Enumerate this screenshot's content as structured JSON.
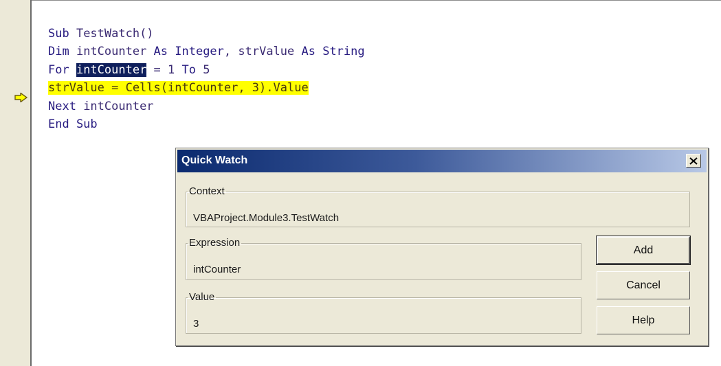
{
  "editor": {
    "code_lines": [
      {
        "parts": [
          {
            "text": "Sub ",
            "cls": "kw"
          },
          {
            "text": "TestWatch()",
            "cls": ""
          }
        ]
      },
      {
        "parts": [
          {
            "text": "Dim ",
            "cls": "kw"
          },
          {
            "text": "intCounter ",
            "cls": ""
          },
          {
            "text": "As Integer",
            "cls": "kw"
          },
          {
            "text": ", strValue ",
            "cls": ""
          },
          {
            "text": "As String",
            "cls": "kw"
          }
        ]
      },
      {
        "parts": [
          {
            "text": "For ",
            "cls": "kw"
          },
          {
            "text": "intCounter",
            "cls": "sel"
          },
          {
            "text": " = 1 ",
            "cls": ""
          },
          {
            "text": "To",
            "cls": "kw"
          },
          {
            "text": " 5",
            "cls": ""
          }
        ]
      },
      {
        "parts": [
          {
            "text": "strValue = Cells(intCounter, 3).Value",
            "cls": "exec"
          }
        ]
      },
      {
        "parts": [
          {
            "text": "Next ",
            "cls": "kw"
          },
          {
            "text": "intCounter",
            "cls": ""
          }
        ]
      },
      {
        "parts": [
          {
            "text": "End Sub",
            "cls": "kw"
          }
        ]
      }
    ],
    "execution_arrow_icon": "current-line-arrow-icon",
    "colors": {
      "keyword": "#261a80",
      "selection": "#0f1f5c",
      "execution_highlight": "#ffff00"
    }
  },
  "dialog": {
    "title": "Quick Watch",
    "close_icon": "close-icon",
    "context": {
      "label": "Context",
      "value": "VBAProject.Module3.TestWatch"
    },
    "expression": {
      "label": "Expression",
      "value": "intCounter"
    },
    "value": {
      "label": "Value",
      "value": "3"
    },
    "buttons": {
      "add": "Add",
      "cancel": "Cancel",
      "help": "Help"
    }
  }
}
